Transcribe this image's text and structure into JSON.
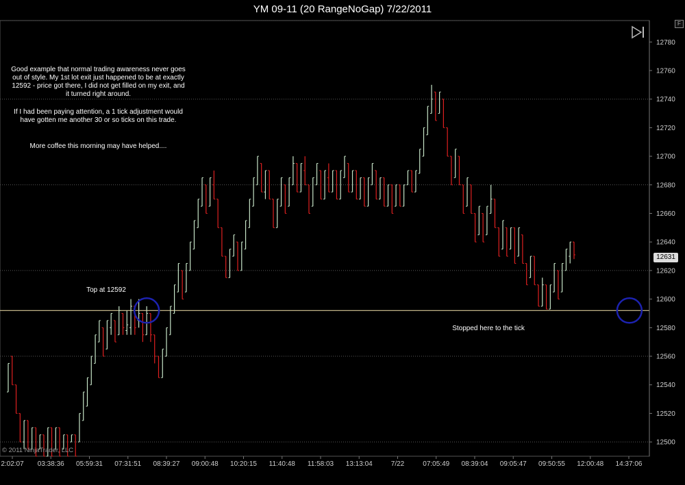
{
  "window": {
    "title": "YM 09-11 (20 RangeNoGap)  7/22/2011",
    "corner_button": "F"
  },
  "annotations": {
    "note_paragraphs": [
      "Good example that normal trading awareness never goes out of style. My 1st lot exit just happened to be at exactly 12592 - price got there, I did not get filled on my exit, and it turned right around.",
      "If I had been paying attention, a 1 tick adjustment would have gotten me another 30 or so ticks on this trade.",
      "More coffee this morning may have helped...."
    ],
    "top_label": "Top at 12592",
    "stop_label": "Stopped here to the tick",
    "copyright": "© 2011 NinjaTrader, LLC",
    "last_price": "12631"
  },
  "colors": {
    "up_bar": "#c8e6c9",
    "down_bar": "#e02020",
    "level_line": "#d8c898",
    "circle": "#1c22b0",
    "grid": "#5a5a5a"
  },
  "chart_data": {
    "type": "ohlc",
    "ylim": [
      12490,
      12795
    ],
    "y_ticks": [
      12500,
      12520,
      12540,
      12560,
      12580,
      12600,
      12620,
      12640,
      12660,
      12680,
      12700,
      12720,
      12740,
      12760,
      12780
    ],
    "y_grid_lines": [
      12500,
      12560,
      12620,
      12680,
      12740,
      12795
    ],
    "x_tick_labels": [
      "2:02:07",
      "03:38:36",
      "05:59:31",
      "07:31:51",
      "08:39:27",
      "09:00:48",
      "10:20:15",
      "11:40:48",
      "11:58:03",
      "13:13:04",
      "7/22",
      "07:05:49",
      "08:39:04",
      "09:05:47",
      "09:50:55",
      "12:00:48",
      "14:37:06"
    ],
    "horizontal_level": 12592,
    "highlight_bar_indices": [
      35,
      157
    ],
    "last_price": 12631,
    "bars": [
      [
        12535,
        12555,
        12535,
        12555
      ],
      [
        12560,
        12560,
        12540,
        12540
      ],
      [
        12540,
        12540,
        12520,
        12520
      ],
      [
        12520,
        12520,
        12500,
        12500
      ],
      [
        12500,
        12515,
        12495,
        12515
      ],
      [
        12515,
        12515,
        12495,
        12495
      ],
      [
        12495,
        12510,
        12495,
        12510
      ],
      [
        12510,
        12510,
        12490,
        12490
      ],
      [
        12495,
        12505,
        12495,
        12505
      ],
      [
        12505,
        12505,
        12490,
        12490
      ],
      [
        12490,
        12510,
        12490,
        12510
      ],
      [
        12510,
        12510,
        12490,
        12490
      ],
      [
        12495,
        12510,
        12495,
        12510
      ],
      [
        12510,
        12510,
        12490,
        12490
      ],
      [
        12495,
        12505,
        12495,
        12505
      ],
      [
        12505,
        12505,
        12490,
        12490
      ],
      [
        12500,
        12505,
        12500,
        12505
      ],
      [
        12505,
        12505,
        12490,
        12490
      ],
      [
        12500,
        12520,
        12500,
        12520
      ],
      [
        12515,
        12535,
        12515,
        12535
      ],
      [
        12525,
        12545,
        12525,
        12545
      ],
      [
        12540,
        12560,
        12540,
        12560
      ],
      [
        12555,
        12575,
        12555,
        12575
      ],
      [
        12570,
        12585,
        12570,
        12585
      ],
      [
        12580,
        12580,
        12560,
        12560
      ],
      [
        12565,
        12585,
        12565,
        12585
      ],
      [
        12580,
        12590,
        12575,
        12590
      ],
      [
        12585,
        12585,
        12570,
        12570
      ],
      [
        12575,
        12595,
        12575,
        12592
      ],
      [
        12590,
        12590,
        12575,
        12580
      ],
      [
        12578,
        12592,
        12575,
        12582
      ],
      [
        12580,
        12600,
        12575,
        12595
      ],
      [
        12595,
        12595,
        12575,
        12580
      ],
      [
        12585,
        12600,
        12580,
        12590
      ],
      [
        12590,
        12590,
        12570,
        12575
      ],
      [
        12575,
        12595,
        12575,
        12590
      ],
      [
        12590,
        12590,
        12570,
        12575
      ],
      [
        12575,
        12575,
        12555,
        12560
      ],
      [
        12560,
        12560,
        12545,
        12545
      ],
      [
        12545,
        12565,
        12545,
        12565
      ],
      [
        12560,
        12580,
        12560,
        12580
      ],
      [
        12575,
        12595,
        12575,
        12595
      ],
      [
        12590,
        12610,
        12590,
        12610
      ],
      [
        12605,
        12625,
        12605,
        12625
      ],
      [
        12620,
        12620,
        12600,
        12600
      ],
      [
        12605,
        12625,
        12605,
        12625
      ],
      [
        12620,
        12640,
        12620,
        12640
      ],
      [
        12635,
        12655,
        12635,
        12655
      ],
      [
        12650,
        12670,
        12650,
        12670
      ],
      [
        12665,
        12685,
        12665,
        12685
      ],
      [
        12680,
        12680,
        12660,
        12660
      ],
      [
        12665,
        12685,
        12665,
        12685
      ],
      [
        12680,
        12690,
        12670,
        12670
      ],
      [
        12670,
        12670,
        12650,
        12650
      ],
      [
        12650,
        12650,
        12630,
        12630
      ],
      [
        12630,
        12630,
        12615,
        12615
      ],
      [
        12615,
        12635,
        12615,
        12635
      ],
      [
        12630,
        12645,
        12630,
        12645
      ],
      [
        12640,
        12640,
        12620,
        12620
      ],
      [
        12620,
        12640,
        12620,
        12640
      ],
      [
        12635,
        12655,
        12635,
        12655
      ],
      [
        12650,
        12670,
        12650,
        12670
      ],
      [
        12665,
        12685,
        12665,
        12685
      ],
      [
        12680,
        12700,
        12680,
        12700
      ],
      [
        12695,
        12695,
        12675,
        12675
      ],
      [
        12675,
        12690,
        12670,
        12690
      ],
      [
        12690,
        12690,
        12670,
        12670
      ],
      [
        12670,
        12670,
        12650,
        12650
      ],
      [
        12650,
        12670,
        12650,
        12670
      ],
      [
        12665,
        12685,
        12665,
        12685
      ],
      [
        12680,
        12680,
        12660,
        12660
      ],
      [
        12665,
        12685,
        12665,
        12685
      ],
      [
        12680,
        12700,
        12680,
        12695
      ],
      [
        12695,
        12695,
        12675,
        12675
      ],
      [
        12675,
        12695,
        12675,
        12695
      ],
      [
        12690,
        12700,
        12680,
        12680
      ],
      [
        12680,
        12680,
        12660,
        12660
      ],
      [
        12665,
        12685,
        12665,
        12685
      ],
      [
        12680,
        12695,
        12680,
        12695
      ],
      [
        12690,
        12690,
        12670,
        12670
      ],
      [
        12670,
        12690,
        12670,
        12690
      ],
      [
        12685,
        12695,
        12675,
        12675
      ],
      [
        12675,
        12690,
        12675,
        12690
      ],
      [
        12690,
        12690,
        12670,
        12670
      ],
      [
        12670,
        12690,
        12670,
        12690
      ],
      [
        12685,
        12700,
        12685,
        12700
      ],
      [
        12695,
        12695,
        12675,
        12675
      ],
      [
        12675,
        12690,
        12675,
        12690
      ],
      [
        12690,
        12690,
        12670,
        12670
      ],
      [
        12670,
        12685,
        12670,
        12685
      ],
      [
        12685,
        12685,
        12665,
        12665
      ],
      [
        12665,
        12685,
        12665,
        12685
      ],
      [
        12680,
        12695,
        12680,
        12695
      ],
      [
        12690,
        12690,
        12670,
        12670
      ],
      [
        12670,
        12685,
        12670,
        12685
      ],
      [
        12685,
        12685,
        12665,
        12665
      ],
      [
        12665,
        12680,
        12665,
        12680
      ],
      [
        12680,
        12680,
        12660,
        12660
      ],
      [
        12665,
        12680,
        12665,
        12680
      ],
      [
        12680,
        12680,
        12665,
        12665
      ],
      [
        12665,
        12680,
        12665,
        12680
      ],
      [
        12680,
        12690,
        12680,
        12690
      ],
      [
        12690,
        12690,
        12675,
        12675
      ],
      [
        12675,
        12690,
        12675,
        12690
      ],
      [
        12688,
        12705,
        12688,
        12705
      ],
      [
        12700,
        12720,
        12700,
        12720
      ],
      [
        12715,
        12735,
        12715,
        12735
      ],
      [
        12730,
        12750,
        12730,
        12740
      ],
      [
        12745,
        12745,
        12725,
        12725
      ],
      [
        12730,
        12745,
        12730,
        12745
      ],
      [
        12740,
        12740,
        12720,
        12720
      ],
      [
        12720,
        12720,
        12700,
        12700
      ],
      [
        12700,
        12700,
        12680,
        12680
      ],
      [
        12685,
        12705,
        12685,
        12705
      ],
      [
        12700,
        12700,
        12680,
        12680
      ],
      [
        12680,
        12680,
        12660,
        12660
      ],
      [
        12665,
        12685,
        12665,
        12685
      ],
      [
        12680,
        12680,
        12660,
        12660
      ],
      [
        12660,
        12660,
        12640,
        12640
      ],
      [
        12645,
        12665,
        12645,
        12665
      ],
      [
        12660,
        12660,
        12640,
        12640
      ],
      [
        12645,
        12665,
        12645,
        12665
      ],
      [
        12660,
        12680,
        12660,
        12670
      ],
      [
        12670,
        12670,
        12650,
        12650
      ],
      [
        12650,
        12650,
        12630,
        12630
      ],
      [
        12635,
        12655,
        12635,
        12655
      ],
      [
        12650,
        12650,
        12630,
        12630
      ],
      [
        12635,
        12650,
        12635,
        12650
      ],
      [
        12650,
        12650,
        12625,
        12625
      ],
      [
        12630,
        12650,
        12630,
        12650
      ],
      [
        12645,
        12645,
        12625,
        12625
      ],
      [
        12625,
        12625,
        12610,
        12610
      ],
      [
        12615,
        12630,
        12615,
        12630
      ],
      [
        12630,
        12630,
        12610,
        12610
      ],
      [
        12610,
        12610,
        12595,
        12595
      ],
      [
        12595,
        12615,
        12595,
        12610
      ],
      [
        12610,
        12610,
        12593,
        12593
      ],
      [
        12593,
        12610,
        12593,
        12610
      ],
      [
        12605,
        12625,
        12605,
        12625
      ],
      [
        12620,
        12620,
        12600,
        12600
      ],
      [
        12605,
        12625,
        12605,
        12625
      ],
      [
        12620,
        12635,
        12620,
        12635
      ],
      [
        12630,
        12640,
        12625,
        12640
      ],
      [
        12640,
        12640,
        12628,
        12631
      ]
    ]
  }
}
